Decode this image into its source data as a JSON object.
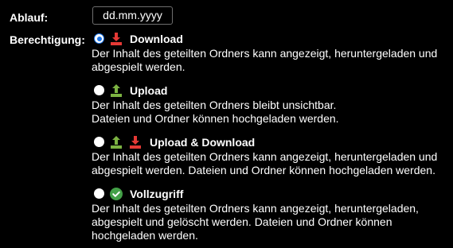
{
  "expiry": {
    "label": "Ablauf:",
    "placeholder": "dd.mm.yyyy"
  },
  "permission": {
    "label": "Berechtigung:",
    "options": [
      {
        "title": "Download",
        "checked": true,
        "icons": [
          "download-icon"
        ],
        "desc": [
          "Der Inhalt des geteilten Ordners kann angezeigt, heruntergeladen und",
          "abgespielt werden."
        ]
      },
      {
        "title": "Upload",
        "checked": false,
        "icons": [
          "upload-icon"
        ],
        "desc": [
          "Der Inhalt des geteilten Ordners bleibt unsichtbar.",
          "Dateien und Ordner können hochgeladen werden."
        ]
      },
      {
        "title": "Upload & Download",
        "checked": false,
        "icons": [
          "upload-icon",
          "download-icon"
        ],
        "desc": [
          "Der Inhalt des geteilten Ordners kann angezeigt, heruntergeladen und",
          "abgespielt werden. Dateien und Ordner können hochgeladen werden."
        ]
      },
      {
        "title": "Vollzugriff",
        "checked": false,
        "icons": [
          "full-access-check-icon"
        ],
        "desc": [
          "Der Inhalt des geteilten Ordners kann angezeigt, heruntergeladen,",
          "abgespielt und gelöscht werden. Dateien und Ordner können",
          "hochgeladen werden."
        ]
      }
    ]
  },
  "colors": {
    "background": "#000000",
    "text": "#ffffff",
    "radio_accent": "#1a73e8",
    "download_icon": "#e53935",
    "upload_icon": "#7cb342",
    "check_icon": "#43a047"
  }
}
